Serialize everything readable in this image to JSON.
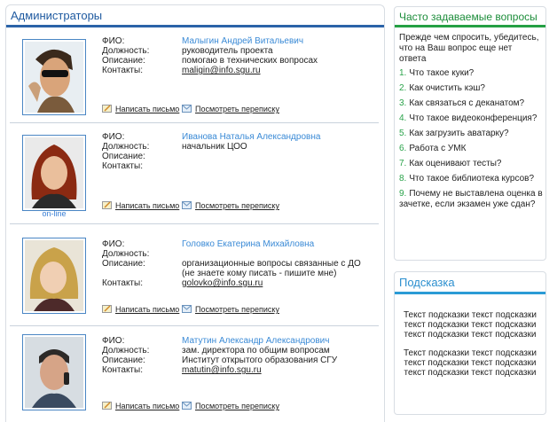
{
  "admins": {
    "title": "Администраторы",
    "labels": {
      "fio": "ФИО:",
      "position": "Должность:",
      "description": "Описание:",
      "contacts": "Контакты:"
    },
    "actions": {
      "write": "Написать письмо",
      "view": "Посмотреть переписку"
    },
    "items": [
      {
        "name": "Малыгин Андрей Витальевич",
        "position": "руководитель проекта",
        "description": "помогаю в технических вопросах",
        "contacts": "maligin@info.sgu.ru",
        "online": ""
      },
      {
        "name": "Иванова Наталья Александровна",
        "position": "начальник ЦОО",
        "description": "",
        "contacts": "",
        "online": "on-line"
      },
      {
        "name": "Головко Екатерина Михайловна",
        "position": "",
        "description": "организационные вопросы связанные с ДО",
        "description2": "(не знаете кому писать - пишите мне)",
        "contacts": "golovko@info.sgu.ru",
        "online": ""
      },
      {
        "name": "Матутин Александр Александрович",
        "position": "зам. директора по общим вопросам",
        "description": "Институт открытого образования СГУ",
        "contacts": "matutin@info.sgu.ru",
        "online": ""
      }
    ]
  },
  "faq": {
    "title": "Часто задаваемые вопросы",
    "intro": "Прежде чем спросить, убедитесь, что на Ваш вопрос еще нет ответа",
    "items": [
      {
        "num": "1.",
        "text": "Что такое куки?"
      },
      {
        "num": "2.",
        "text": "Как очистить кэш?"
      },
      {
        "num": "3.",
        "text": "Как связаться с деканатом?"
      },
      {
        "num": "4.",
        "text": "Что такое видеоконференция?"
      },
      {
        "num": "5.",
        "text": "Как загрузить аватарку?"
      },
      {
        "num": "6.",
        "text": "Работа с УМК"
      },
      {
        "num": "7.",
        "text": "Как оценивают тесты?"
      },
      {
        "num": "8.",
        "text": "Что такое библиотека курсов?"
      },
      {
        "num": "9.",
        "text": "Почему не выставлена оценка в зачетке, если экзамен уже сдан?"
      }
    ]
  },
  "hint": {
    "title": "Подсказка",
    "paragraphs": [
      "Текст подсказки текст подсказки текст подсказки текст подсказки текст подсказки текст подсказки",
      "Текст подсказки текст подсказки текст подсказки текст подсказки текст подсказки текст подсказки"
    ]
  }
}
